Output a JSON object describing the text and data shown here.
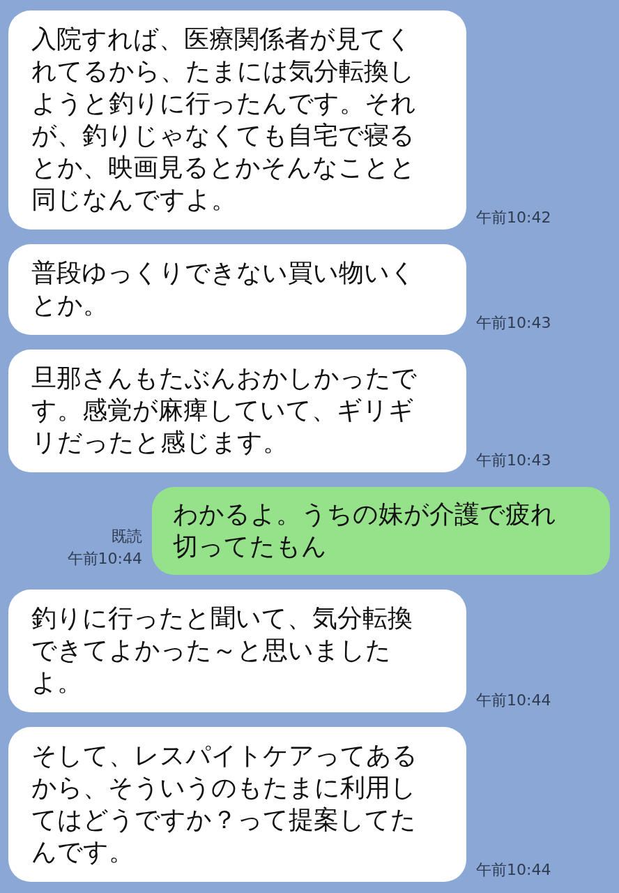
{
  "messages": [
    {
      "kind": "incoming",
      "lines": [
        "入院すれば、医療関係者が見てく",
        "れてるから、たまには気分転換し",
        "ようと釣りに行ったんです。それ",
        "が、釣りじゃなくても自宅で寝る",
        "とか、映画見るとかそんなことと",
        "同じなんですよ。"
      ],
      "time": "午前10:42"
    },
    {
      "kind": "incoming",
      "lines": [
        "普段ゆっくりできない買い物いく",
        "とか。"
      ],
      "time": "午前10:43"
    },
    {
      "kind": "incoming",
      "lines": [
        "旦那さんもたぶんおかしかったで",
        "す。感覚が麻痺していて、ギリギ",
        "リだったと感じます。"
      ],
      "time": "午前10:43"
    },
    {
      "kind": "outgoing",
      "lines": [
        "わかるよ。うちの妹が介護で疲れ",
        "切ってたもん"
      ],
      "read_label": "既読",
      "time": "午前10:44"
    },
    {
      "kind": "incoming",
      "lines": [
        "釣りに行ったと聞いて、気分転換",
        "できてよかった～と思いました",
        "よ。"
      ],
      "time": "午前10:44"
    },
    {
      "kind": "incoming",
      "lines": [
        "そして、レスパイトケアってある",
        "から、そういうのもたまに利用し",
        "てはどうですか？って提案してた",
        "んです。"
      ],
      "time": "午前10:44"
    }
  ]
}
